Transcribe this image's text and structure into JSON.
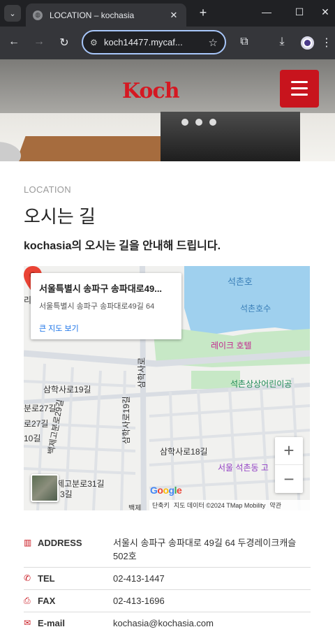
{
  "browser": {
    "tab_title": "LOCATION – kochasia",
    "url": "koch14477.mycaf..."
  },
  "header": {
    "logo_text": "Koch",
    "brand_color": "#c8141d"
  },
  "section": {
    "label": "LOCATION",
    "heading": "오시는 길",
    "subheading": "kochasia의 오시는 길을 안내해 드립니다."
  },
  "map": {
    "card": {
      "name": "서울특별시 송파구 송파대로49...",
      "address": "서울특별시 송파구 송파대로49길 64",
      "link": "큰 지도 보기"
    },
    "labels": {
      "lake": "석촌호",
      "lake2": "석촌호수",
      "hotel": "레이크 호텔",
      "kindergarten": "석촌상상어린이공",
      "road1": "삼학사로19길",
      "road2": "삼학사로",
      "road3": "삼학사로19길",
      "road4": "삼학사로18길",
      "road5": "분로27길",
      "road6": "로27길",
      "road7": "10길",
      "road8": "백제고분로29길",
      "road9": "백제고분로31길",
      "road10": "3길",
      "road11": "백제",
      "district": "서울 석촌동 고",
      "left_edge": "리"
    },
    "zoom_in": "+",
    "zoom_out": "−",
    "google": "Google",
    "attribution": {
      "shortcuts": "단축키",
      "data": "지도 데이터 ©2024 TMap Mobility",
      "terms": "약관"
    }
  },
  "info": [
    {
      "icon": "map-icon",
      "label": "ADDRESS",
      "value": "서울시 송파구 송파대로 49길 64 두경레이크캐슬 502호"
    },
    {
      "icon": "phone-icon",
      "label": "TEL",
      "value": "02-413-1447"
    },
    {
      "icon": "fax-icon",
      "label": "FAX",
      "value": "02-413-1696"
    },
    {
      "icon": "mail-icon",
      "label": "E-mail",
      "value": "kochasia@kochasia.com"
    }
  ]
}
